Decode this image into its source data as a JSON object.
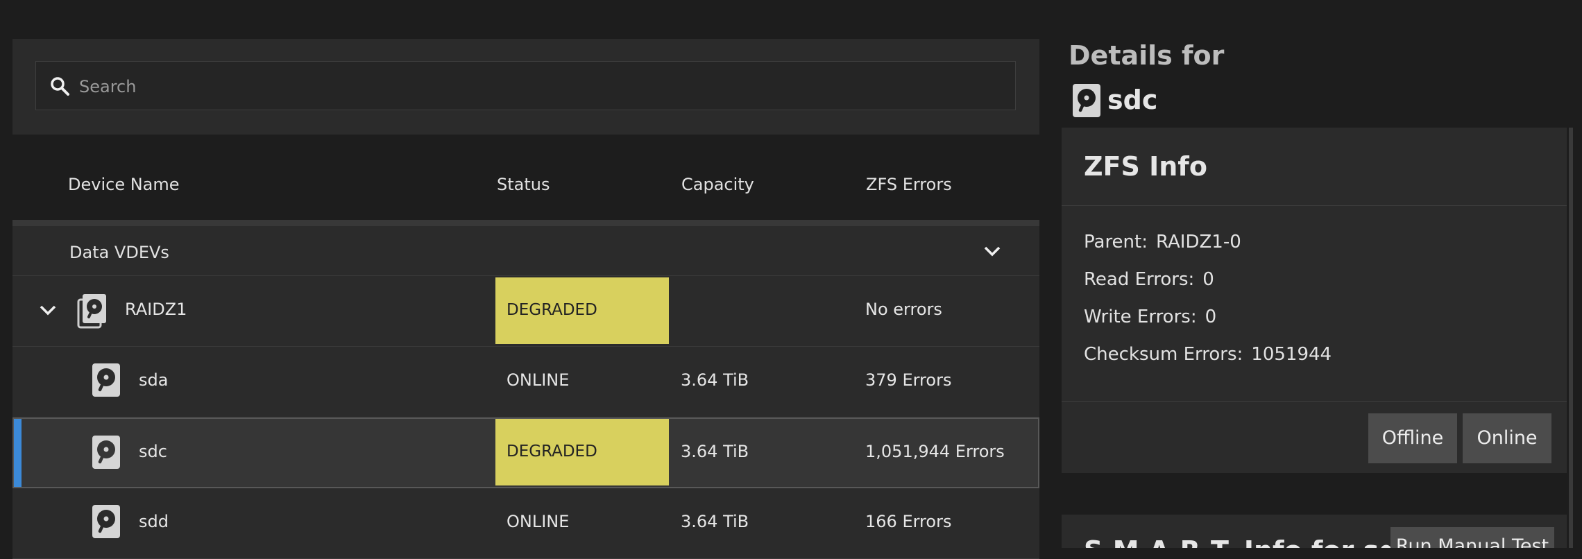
{
  "search": {
    "placeholder": "Search"
  },
  "table": {
    "headers": {
      "device": "Device Name",
      "status": "Status",
      "capacity": "Capacity",
      "errors": "ZFS Errors"
    },
    "group": {
      "label": "Data VDEVs"
    },
    "rows": [
      {
        "name": "RAIDZ1",
        "status": "DEGRADED",
        "capacity": "",
        "errors": "No errors"
      },
      {
        "name": "sda",
        "status": "ONLINE",
        "capacity": "3.64 TiB",
        "errors": "379 Errors"
      },
      {
        "name": "sdc",
        "status": "DEGRADED",
        "capacity": "3.64 TiB",
        "errors": "1,051,944 Errors"
      },
      {
        "name": "sdd",
        "status": "ONLINE",
        "capacity": "3.64 TiB",
        "errors": "166 Errors"
      }
    ]
  },
  "details": {
    "title": "Details for",
    "disk": "sdc",
    "zfs_info": {
      "title": "ZFS Info",
      "parent_label": "Parent:",
      "parent_value": "RAIDZ1-0",
      "read_label": "Read Errors:",
      "read_value": "0",
      "write_label": "Write Errors:",
      "write_value": "0",
      "checksum_label": "Checksum Errors:",
      "checksum_value": "1051944",
      "offline_button": "Offline",
      "online_button": "Online"
    },
    "smart": {
      "title": "S.M.A.R.T. Info for sdc",
      "button": "Run Manual Test"
    }
  },
  "colors": {
    "degraded": "#d8d05e",
    "selected_accent": "#3c8ad8",
    "background": "#1d1d1d",
    "panel": "#2b2b2b"
  }
}
